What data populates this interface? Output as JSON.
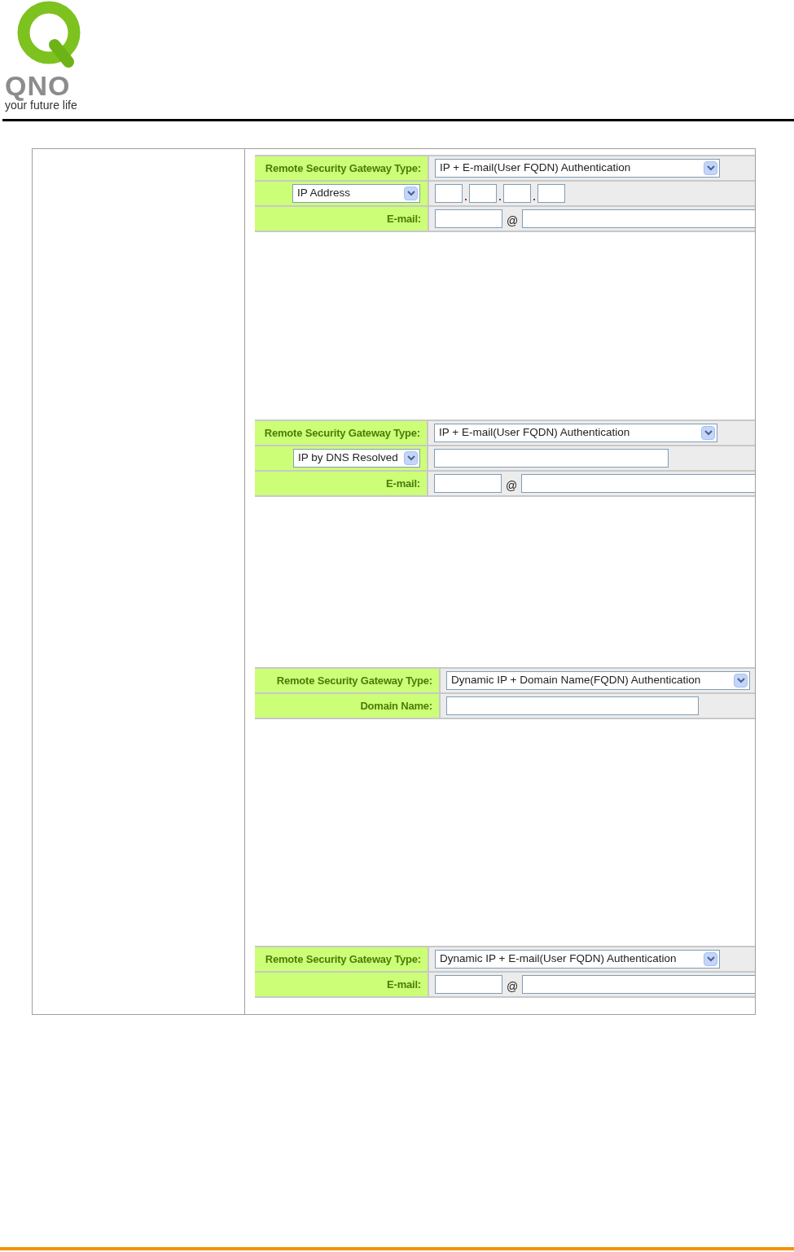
{
  "logo": {
    "letters": "QNO",
    "tagline": "your future life"
  },
  "panels": [
    {
      "rows": [
        {
          "kind": "select",
          "label": "Remote Security Gateway Type:",
          "value": "IP + E-mail(User FQDN) Authentication"
        },
        {
          "kind": "ip",
          "selector": "IP Address"
        },
        {
          "kind": "email",
          "label": "E-mail:",
          "at": "@"
        }
      ]
    },
    {
      "rows": [
        {
          "kind": "select",
          "label": "Remote Security Gateway Type:",
          "value": "IP + E-mail(User FQDN) Authentication"
        },
        {
          "kind": "dns",
          "selector": "IP by DNS Resolved"
        },
        {
          "kind": "email",
          "label": "E-mail:",
          "at": "@"
        }
      ]
    },
    {
      "rows": [
        {
          "kind": "select",
          "label": "Remote Security Gateway Type:",
          "value": "Dynamic IP + Domain Name(FQDN) Authentication"
        },
        {
          "kind": "domain",
          "label": "Domain Name:"
        }
      ]
    },
    {
      "rows": [
        {
          "kind": "select",
          "label": "Remote Security Gateway Type:",
          "value": "Dynamic IP + E-mail(User FQDN) Authentication"
        },
        {
          "kind": "email",
          "label": "E-mail:",
          "at": "@"
        }
      ]
    }
  ]
}
